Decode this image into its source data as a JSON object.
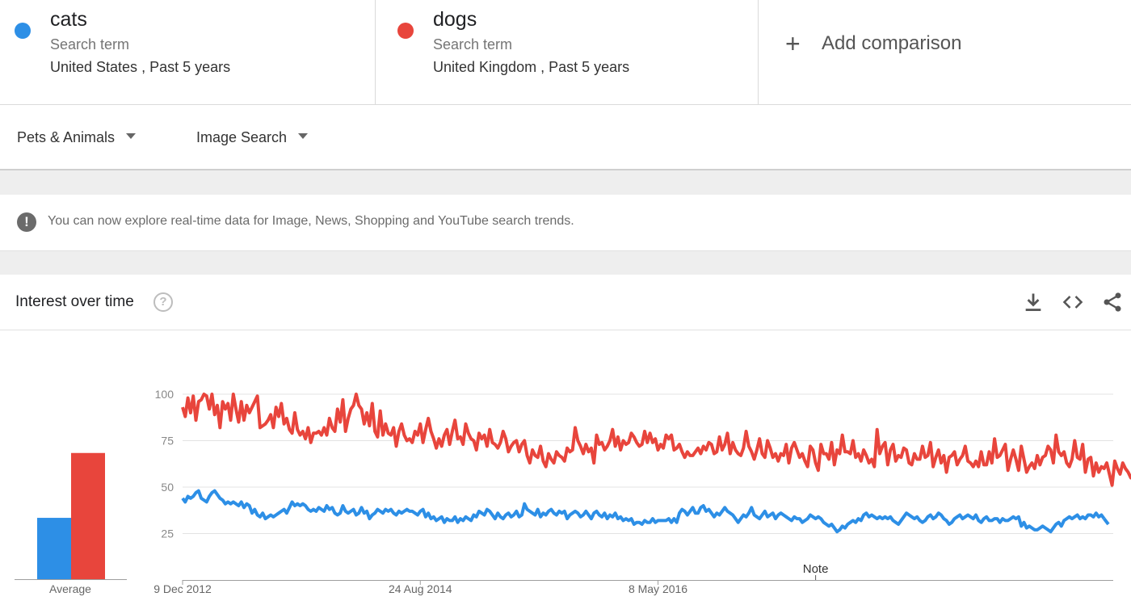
{
  "terms": [
    {
      "name": "cats",
      "kind": "Search term",
      "scope": "United States , Past 5 years",
      "color": "#2d8fe6"
    },
    {
      "name": "dogs",
      "kind": "Search term",
      "scope": "United Kingdom , Past 5 years",
      "color": "#e8453c"
    }
  ],
  "add_comparison": {
    "icon": "plus-icon",
    "label": "Add comparison"
  },
  "filters": [
    {
      "label": "Pets & Animals",
      "icon": "caret-down-icon"
    },
    {
      "label": "Image Search",
      "icon": "caret-down-icon"
    }
  ],
  "notice": {
    "icon": "exclamation-icon",
    "text": "You can now explore real-time data for Image, News, Shopping and YouTube search trends."
  },
  "card": {
    "title": "Interest over time",
    "help_icon": "help-circle-icon",
    "help_glyph": "?",
    "tools": [
      "download-icon",
      "embed-code-icon",
      "share-icon"
    ]
  },
  "chart_data": [
    {
      "type": "bar",
      "categories": [
        "Average"
      ],
      "xlabel": "Average",
      "series": [
        {
          "name": "cats",
          "values": [
            35
          ],
          "color": "#2d8fe6"
        },
        {
          "name": "dogs",
          "values": [
            72
          ],
          "color": "#e8453c"
        }
      ],
      "ylim": [
        0,
        100
      ]
    },
    {
      "type": "line",
      "ylim": [
        0,
        100
      ],
      "yticks": [
        25,
        50,
        75,
        100
      ],
      "grid": true,
      "x_start": "2012-12-09",
      "x_step_days": 7,
      "xtick_labels": [
        {
          "label": "9 Dec 2012",
          "date": "2012-12-09"
        },
        {
          "label": "24 Aug 2014",
          "date": "2014-08-24"
        },
        {
          "label": "8 May 2016",
          "date": "2016-05-08"
        }
      ],
      "annotation": {
        "label": "Note",
        "date": "2017-06-25"
      },
      "partial_last_point": true,
      "series": [
        {
          "name": "cats",
          "color": "#2d8fe6",
          "values": [
            44,
            42,
            45,
            44,
            45,
            47,
            48,
            44,
            43,
            42,
            45,
            47,
            48,
            46,
            44,
            43,
            41,
            42,
            41,
            42,
            41,
            40,
            42,
            39,
            41,
            40,
            36,
            38,
            35,
            34,
            36,
            33,
            34,
            35,
            34,
            35,
            36,
            37,
            38,
            36,
            39,
            42,
            40,
            41,
            40,
            41,
            40,
            38,
            37,
            38,
            37,
            39,
            38,
            37,
            40,
            38,
            39,
            36,
            35,
            36,
            40,
            37,
            36,
            37,
            38,
            35,
            36,
            39,
            36,
            37,
            33,
            35,
            36,
            38,
            37,
            36,
            38,
            37,
            38,
            36,
            35,
            37,
            36,
            37,
            38,
            37,
            37,
            36,
            35,
            37,
            38,
            34,
            36,
            33,
            34,
            32,
            33,
            34,
            31,
            33,
            32,
            32,
            34,
            31,
            33,
            32,
            34,
            33,
            32,
            35,
            34,
            37,
            36,
            35,
            38,
            37,
            35,
            33,
            36,
            34,
            33,
            35,
            36,
            34,
            35,
            37,
            34,
            35,
            41,
            38,
            37,
            36,
            35,
            38,
            34,
            36,
            35,
            37,
            38,
            36,
            35,
            37,
            36,
            37,
            33,
            35,
            36,
            37,
            36,
            34,
            35,
            37,
            35,
            33,
            36,
            37,
            35,
            34,
            36,
            33,
            35,
            34,
            36,
            33,
            34,
            32,
            33,
            32,
            33,
            30,
            31,
            31,
            30,
            32,
            31,
            31,
            33,
            31,
            32,
            32,
            32,
            32,
            33,
            31,
            33,
            31,
            36,
            38,
            37,
            35,
            37,
            39,
            36,
            36,
            39,
            40,
            37,
            38,
            36,
            34,
            36,
            35,
            37,
            39,
            37,
            36,
            35,
            33,
            31,
            33,
            35,
            34,
            36,
            39,
            35,
            34,
            33,
            35,
            37,
            34,
            35,
            36,
            33,
            35,
            36,
            35,
            34,
            33,
            32,
            34,
            33,
            33,
            31,
            32,
            33,
            35,
            34,
            33,
            34,
            33,
            31,
            30,
            29,
            30,
            28,
            26,
            27,
            29,
            28,
            30,
            31,
            32,
            31,
            33,
            32,
            35,
            36,
            34,
            35,
            34,
            33,
            34,
            33,
            34,
            33,
            34,
            32,
            31,
            30,
            32,
            34,
            36,
            35,
            34,
            33,
            34,
            32,
            31,
            32,
            34,
            35,
            33,
            34,
            36,
            35,
            33,
            32,
            30,
            31,
            33,
            34,
            35,
            33,
            34,
            35,
            34,
            33,
            35,
            32,
            31,
            33,
            34,
            32,
            32,
            33,
            33,
            31,
            33,
            32,
            32,
            33,
            34,
            33,
            34,
            29,
            31,
            28,
            29,
            28,
            27,
            27,
            28,
            29,
            28,
            27,
            26,
            28,
            30,
            31,
            29,
            32,
            33,
            34,
            33,
            34,
            35,
            33,
            34,
            33,
            35,
            35,
            34,
            36,
            34,
            35,
            33,
            30
          ]
        },
        {
          "name": "dogs",
          "color": "#e8453c",
          "values": [
            93,
            88,
            98,
            90,
            99,
            86,
            96,
            97,
            100,
            99,
            92,
            100,
            89,
            94,
            82,
            96,
            92,
            95,
            86,
            100,
            92,
            85,
            96,
            86,
            94,
            90,
            93,
            96,
            99,
            82,
            83,
            84,
            86,
            89,
            82,
            93,
            88,
            95,
            84,
            87,
            81,
            79,
            90,
            81,
            78,
            80,
            76,
            82,
            74,
            79,
            79,
            80,
            78,
            82,
            78,
            87,
            82,
            80,
            92,
            85,
            97,
            80,
            87,
            92,
            94,
            100,
            94,
            92,
            84,
            90,
            83,
            95,
            80,
            77,
            91,
            78,
            84,
            79,
            78,
            82,
            72,
            80,
            84,
            78,
            75,
            76,
            74,
            80,
            78,
            84,
            74,
            81,
            87,
            80,
            76,
            71,
            76,
            72,
            78,
            81,
            73,
            80,
            86,
            76,
            77,
            73,
            84,
            79,
            76,
            75,
            70,
            79,
            76,
            78,
            72,
            81,
            74,
            73,
            71,
            74,
            80,
            76,
            69,
            72,
            74,
            75,
            69,
            73,
            75,
            67,
            63,
            70,
            67,
            66,
            72,
            64,
            61,
            68,
            65,
            63,
            69,
            67,
            66,
            64,
            71,
            69,
            70,
            82,
            75,
            72,
            68,
            73,
            69,
            71,
            63,
            78,
            73,
            74,
            70,
            72,
            75,
            81,
            72,
            77,
            70,
            75,
            73,
            74,
            79,
            77,
            74,
            72,
            73,
            80,
            74,
            79,
            74,
            76,
            70,
            73,
            71,
            78,
            76,
            78,
            70,
            71,
            73,
            69,
            66,
            69,
            67,
            67,
            69,
            71,
            68,
            72,
            70,
            74,
            73,
            68,
            69,
            77,
            70,
            73,
            79,
            68,
            74,
            70,
            68,
            67,
            71,
            80,
            72,
            69,
            65,
            70,
            76,
            68,
            66,
            75,
            71,
            66,
            68,
            64,
            68,
            67,
            73,
            63,
            71,
            74,
            70,
            66,
            68,
            64,
            61,
            72,
            70,
            63,
            59,
            73,
            68,
            68,
            65,
            74,
            62,
            70,
            68,
            78,
            69,
            69,
            68,
            75,
            66,
            68,
            64,
            70,
            67,
            63,
            65,
            61,
            81,
            68,
            72,
            74,
            62,
            70,
            73,
            64,
            67,
            66,
            71,
            70,
            63,
            62,
            68,
            65,
            65,
            72,
            66,
            67,
            74,
            61,
            66,
            70,
            63,
            67,
            58,
            66,
            67,
            69,
            62,
            65,
            67,
            72,
            64,
            63,
            61,
            64,
            61,
            69,
            62,
            62,
            69,
            63,
            76,
            66,
            67,
            70,
            73,
            59,
            65,
            70,
            65,
            59,
            72,
            65,
            58,
            61,
            63,
            60,
            67,
            62,
            66,
            67,
            72,
            70,
            63,
            78,
            69,
            67,
            69,
            63,
            61,
            65,
            75,
            66,
            65,
            73,
            58,
            65,
            66,
            56,
            63,
            58,
            61,
            60,
            63,
            57,
            51,
            64,
            60,
            57,
            63,
            60,
            58,
            55,
            58,
            60,
            60,
            61,
            68,
            62,
            67,
            64,
            56,
            59,
            62,
            59,
            68,
            61,
            67,
            58,
            53,
            57,
            66,
            67,
            56,
            53,
            64,
            62,
            61,
            61
          ]
        }
      ],
      "partial_dogs_end": 40
    }
  ]
}
